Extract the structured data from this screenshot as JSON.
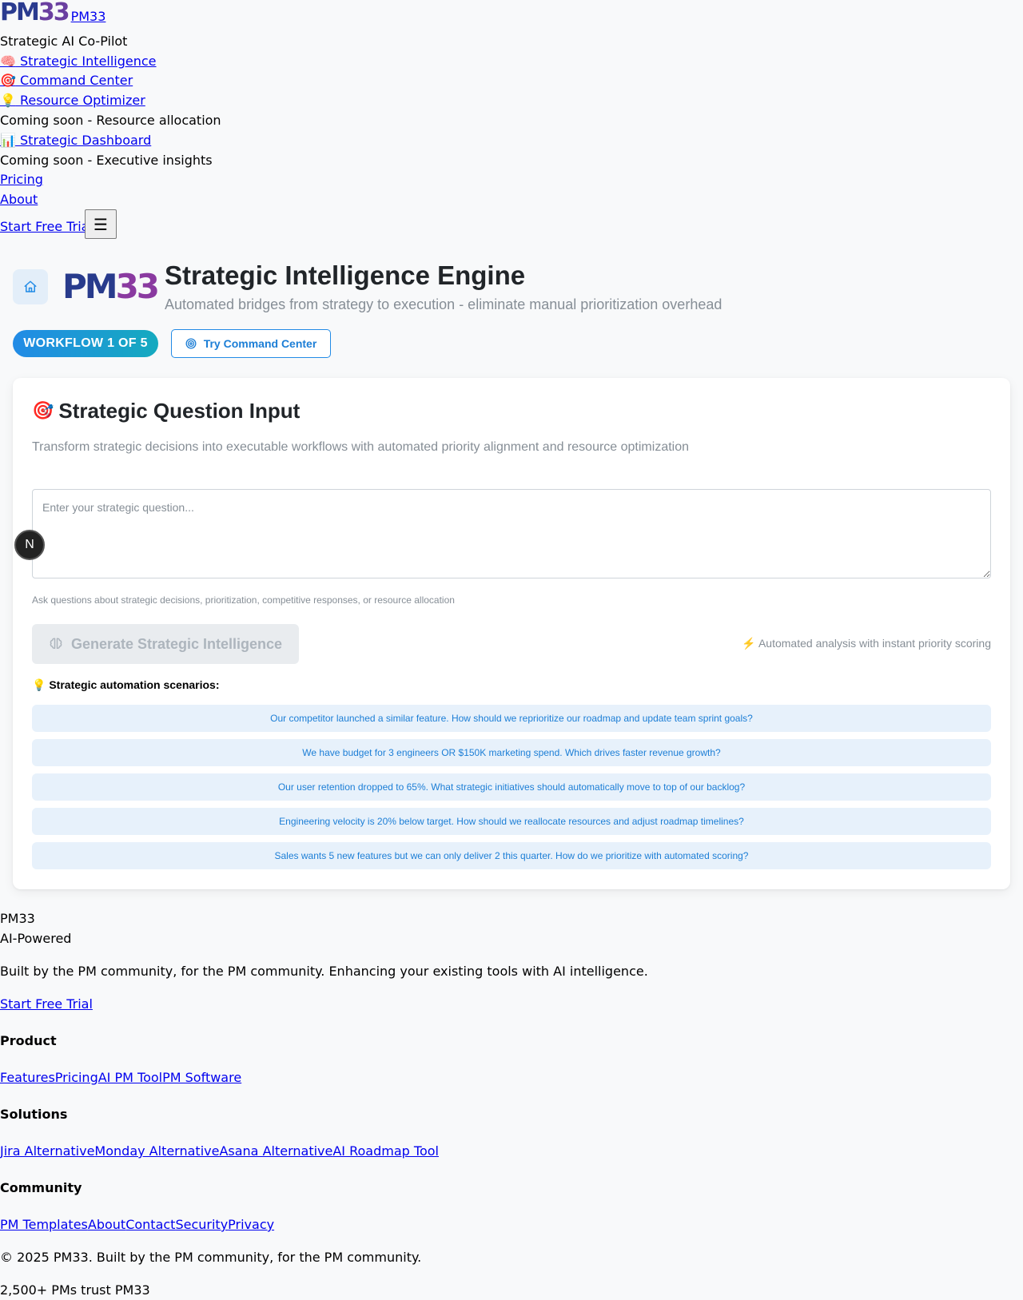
{
  "nav": {
    "logo_pm": "PM",
    "logo_33": "33",
    "brand_link": "PM33",
    "tagline": "Strategic AI Co-Pilot",
    "items": [
      {
        "icon": "🧠",
        "label": "Strategic Intelligence"
      },
      {
        "icon": "🎯",
        "label": "Command Center"
      },
      {
        "icon": "💡",
        "label": "Resource Optimizer",
        "note": "Coming soon - Resource allocation"
      },
      {
        "icon": "📊",
        "label": "Strategic Dashboard",
        "note": "Coming soon - Executive insights"
      }
    ],
    "pricing": "Pricing",
    "about": "About",
    "cta": "Start Free Trial",
    "menu_icon": "☰"
  },
  "header": {
    "brand_pm": "PM",
    "brand_33": "33",
    "title": "Strategic Intelligence Engine",
    "subtitle": "Automated bridges from strategy to execution - eliminate manual prioritization overhead",
    "workflow_badge": "WORKFLOW 1 OF 5",
    "try_button": "Try Command Center"
  },
  "card": {
    "title_icon": "🎯",
    "title": "Strategic Question Input",
    "description": "Transform strategic decisions into executable workflows with automated priority alignment and resource optimization",
    "input_placeholder": "Enter your strategic question...",
    "input_hint": "Ask questions about strategic decisions, prioritization, competitive responses, or resource allocation",
    "generate_button": "Generate Strategic Intelligence",
    "auto_note_icon": "⚡",
    "auto_note": "Automated analysis with instant priority scoring",
    "scenarios_icon": "💡",
    "scenarios_title": "Strategic automation scenarios:",
    "scenarios": [
      "Our competitor launched a similar feature. How should we reprioritize our roadmap and update team sprint goals?",
      "We have budget for 3 engineers OR $150K marketing spend. Which drives faster revenue growth?",
      "Our user retention dropped to 65%. What strategic initiatives should automatically move to top of our backlog?",
      "Engineering velocity is 20% below target. How should we reallocate resources and adjust roadmap timelines?",
      "Sales wants 5 new features but we can only deliver 2 this quarter. How do we prioritize with automated scoring?"
    ]
  },
  "dev_badge": "N",
  "footer": {
    "brand": "PM33",
    "brand_sub": "AI-Powered",
    "blurb": "Built by the PM community, for the PM community. Enhancing your existing tools with AI intelligence.",
    "cta": "Start Free Trial",
    "product_heading": "Product",
    "product_links": [
      "Features",
      "Pricing",
      "AI PM Tool",
      "PM Software"
    ],
    "solutions_heading": "Solutions",
    "solutions_links": [
      "Jira Alternative",
      "Monday Alternative",
      "Asana Alternative",
      "AI Roadmap Tool"
    ],
    "community_heading": "Community",
    "community_links": [
      "PM Templates",
      "About",
      "Contact",
      "Security",
      "Privacy"
    ],
    "copyright": "© 2025 PM33. Built by the PM community, for the PM community.",
    "trust": "2,500+ PMs trust PM33"
  },
  "colors": {
    "accent": "#228be6",
    "scenario_bg": "#e7f1fb",
    "scenario_text": "#1c7ed6",
    "page_bg": "#f8f9fa"
  }
}
